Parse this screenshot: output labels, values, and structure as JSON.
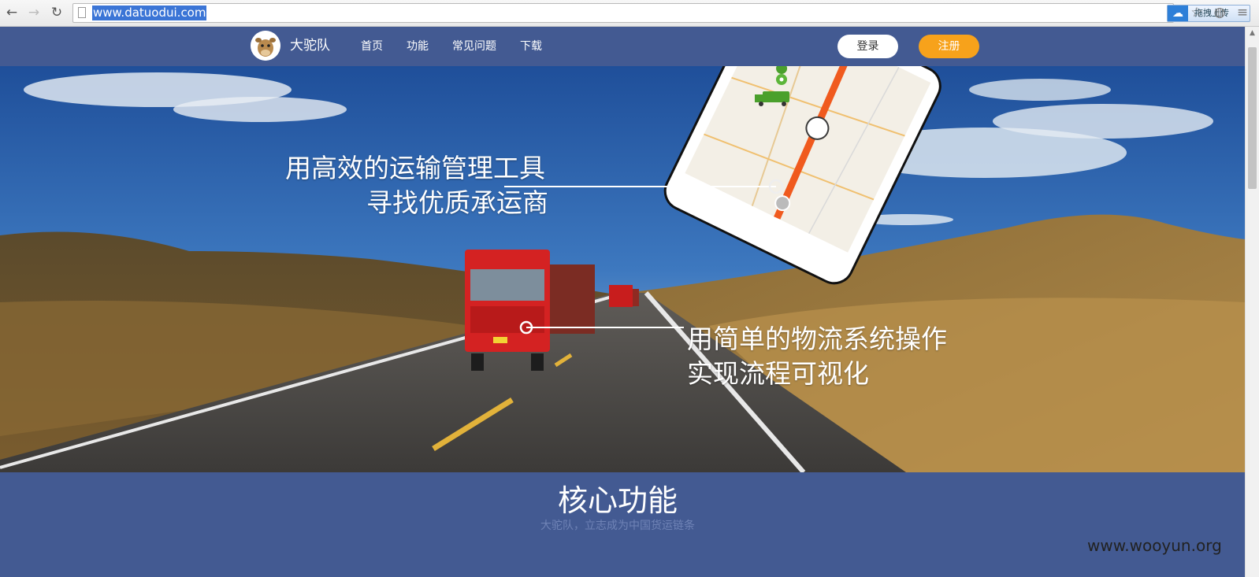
{
  "browser": {
    "url": "www.datuodui.com",
    "extension_label": "拖拽上传",
    "icons": [
      "back-icon",
      "forward-icon",
      "reload-icon",
      "page-icon",
      "star-icon",
      "globe-icon",
      "menu-icon"
    ]
  },
  "header": {
    "brand": "大驼队",
    "nav": [
      "首页",
      "功能",
      "常见问题",
      "下载"
    ],
    "login": "登录",
    "register": "注册",
    "colors": {
      "header_bg": "#435a92",
      "register_bg": "#f7a21b"
    }
  },
  "hero": {
    "line1a": "用高效的运输管理工具",
    "line1b": "寻找优质承运商",
    "line2a": "用简单的物流系统操作",
    "line2b": "实现流程可视化",
    "truck_plate": "",
    "map_pin": "map-pin-icon"
  },
  "core": {
    "title": "核心功能",
    "subtitle": "大驼队，立志成为中国货运链条"
  },
  "watermark": "www.wooyun.org"
}
